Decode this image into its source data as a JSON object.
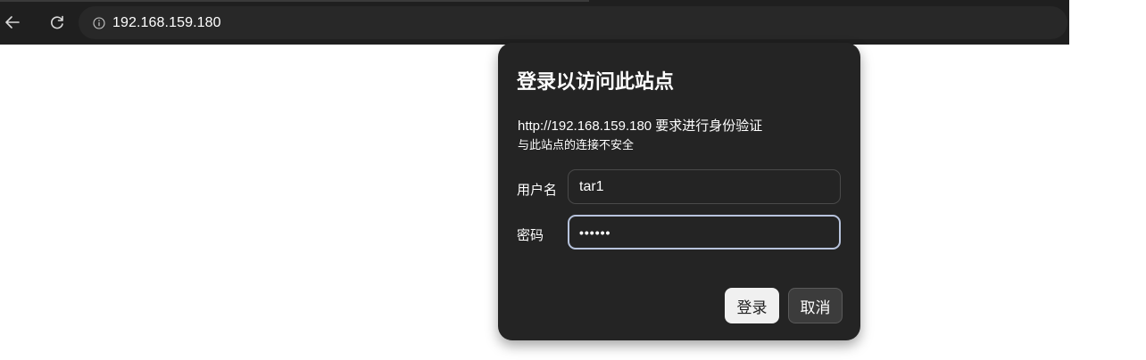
{
  "browser": {
    "url": "192.168.159.180",
    "icons": {
      "back": "back-arrow-icon",
      "reload": "reload-icon",
      "site_info": "info-icon"
    }
  },
  "dialog": {
    "title": "登录以访问此站点",
    "origin_message": "http://192.168.159.180 要求进行身份验证",
    "warning": "与此站点的连接不安全",
    "username_label": "用户名",
    "username_value": "tar1",
    "password_label": "密码",
    "password_value": "••••••",
    "login_button": "登录",
    "cancel_button": "取消"
  },
  "colors": {
    "toolbar": "#1f1f1f",
    "dialog_bg": "#242424",
    "focus_border": "#b7c3dc"
  }
}
